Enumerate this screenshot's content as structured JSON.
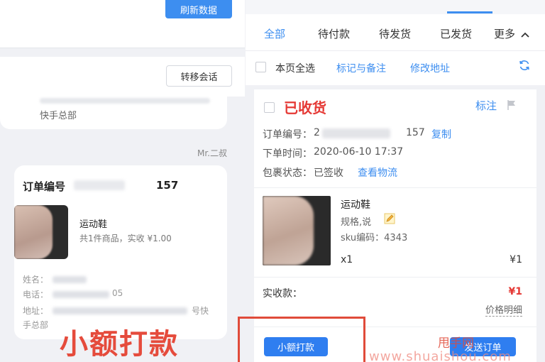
{
  "left": {
    "refresh_button": "刷新数据",
    "transfer_button": "转移会话",
    "message_tail": "快手总部",
    "sender": "Mr.二叔",
    "order_card": {
      "order_no_label": "订单编号",
      "order_no_suffix": "157",
      "product_name": "运动鞋",
      "product_summary": "共1件商品，实收 ¥1.00",
      "name_label": "姓名：",
      "phone_label": "电话：",
      "phone_suffix": "05",
      "address_label": "地址：",
      "address_suffix": "号快",
      "address_tail": "手总部"
    },
    "annotation": "小额打款"
  },
  "right": {
    "tabs": [
      {
        "label": "全部",
        "active": true
      },
      {
        "label": "待付款",
        "active": false
      },
      {
        "label": "待发货",
        "active": false
      },
      {
        "label": "已发货",
        "active": false
      },
      {
        "label": "更多",
        "active": false
      }
    ],
    "toolbar": {
      "select_all": "本页全选",
      "mark_note": "标记与备注",
      "edit_address": "修改地址"
    },
    "order": {
      "status": "已收货",
      "mark": "标注",
      "order_no_label": "订单编号：",
      "order_no_prefix": "2",
      "order_no_suffix": "157",
      "copy": "复制",
      "order_time_label": "下单时间：",
      "order_time": "2020-06-10 17:37",
      "package_label": "包裹状态：",
      "package_status": "已签收",
      "logistics": "查看物流",
      "product_name": "运动鞋",
      "spec": "规格,说",
      "sku": "sku编码：4343",
      "qty": "x1",
      "price": "¥1",
      "paid_label": "实收款：",
      "paid_value": "¥1",
      "price_detail": "价格明细"
    },
    "actions": {
      "small_payment": "小额打款",
      "send_order": "发送订单"
    }
  },
  "watermark": {
    "cn": "甩手网",
    "url": "www.shuaishou.com"
  },
  "colors": {
    "accent": "#3d8ef0",
    "status_red": "#e53935",
    "annotation_red": "#e04b3a"
  }
}
